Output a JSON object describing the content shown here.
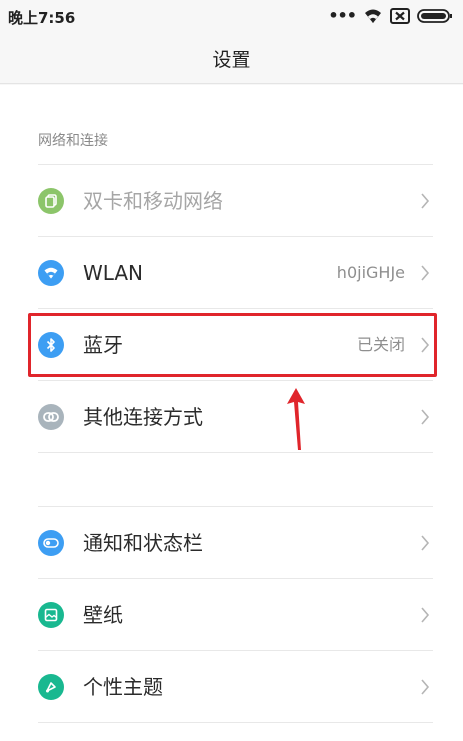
{
  "status_bar": {
    "time": "晚上7:56",
    "icons": [
      "more-dots-icon",
      "wifi-icon",
      "no-sim-icon",
      "battery-icon"
    ]
  },
  "header": {
    "title": "设置"
  },
  "sections": [
    {
      "header": "网络和连接",
      "items": [
        {
          "label": "双卡和移动网络",
          "value": "",
          "icon": "dual-sim-icon",
          "color": "#8cc56a",
          "disabled": true
        },
        {
          "label": "WLAN",
          "value": "h0jiGHJe",
          "icon": "wifi-icon",
          "color": "#3d9ef3",
          "disabled": false
        },
        {
          "label": "蓝牙",
          "value": "已关闭",
          "icon": "bluetooth-icon",
          "color": "#3d9ef3",
          "disabled": false,
          "highlighted": true
        },
        {
          "label": "其他连接方式",
          "value": "",
          "icon": "link-icon",
          "color": "#a9b4bc",
          "disabled": false
        }
      ]
    },
    {
      "header": "",
      "items": [
        {
          "label": "通知和状态栏",
          "value": "",
          "icon": "toggle-icon",
          "color": "#3d9ef3",
          "disabled": false
        },
        {
          "label": "壁纸",
          "value": "",
          "icon": "wallpaper-icon",
          "color": "#19b890",
          "disabled": false
        },
        {
          "label": "个性主题",
          "value": "",
          "icon": "theme-brush-icon",
          "color": "#19b890",
          "disabled": false
        }
      ]
    }
  ],
  "annotation": {
    "highlight_color": "#e0252b",
    "arrow_color": "#e0252b"
  }
}
